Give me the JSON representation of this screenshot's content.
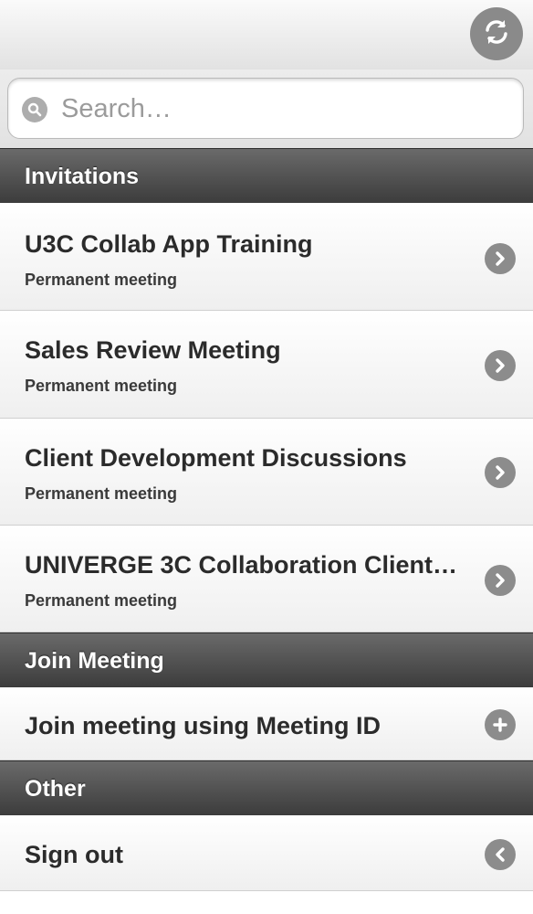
{
  "header": {
    "refresh_icon": "refresh-icon"
  },
  "search": {
    "placeholder": "Search…",
    "value": "",
    "icon": "search-icon"
  },
  "sections": {
    "invitations": {
      "label": "Invitations",
      "items": [
        {
          "title": "U3C Collab App Training",
          "subtitle": "Permanent meeting",
          "icon": "chevron-right-icon"
        },
        {
          "title": "Sales Review Meeting",
          "subtitle": "Permanent meeting",
          "icon": "chevron-right-icon"
        },
        {
          "title": "Client Development Discussions",
          "subtitle": "Permanent meeting",
          "icon": "chevron-right-icon"
        },
        {
          "title": "UNIVERGE 3C Collaboration Client…",
          "subtitle": "Permanent meeting",
          "icon": "chevron-right-icon"
        }
      ]
    },
    "join": {
      "label": "Join Meeting",
      "items": [
        {
          "title": "Join meeting using Meeting ID",
          "icon": "plus-icon"
        }
      ]
    },
    "other": {
      "label": "Other",
      "items": [
        {
          "title": "Sign out",
          "icon": "chevron-left-icon"
        }
      ]
    }
  },
  "colors": {
    "header_bg": "#4a4a4a",
    "icon_gray": "#8c8c8c",
    "text_dark": "#2b2b2b"
  }
}
